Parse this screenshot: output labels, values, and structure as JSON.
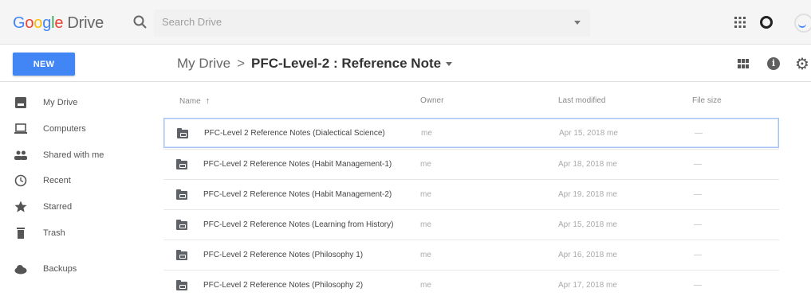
{
  "header": {
    "logo_brand": [
      "G",
      "o",
      "o",
      "g",
      "l",
      "e"
    ],
    "logo_product": "Drive",
    "search_placeholder": "Search Drive"
  },
  "toolbar": {
    "new_label": "NEW",
    "breadcrumb_root": "My Drive",
    "breadcrumb_separator": ">",
    "breadcrumb_current": "PFC-Level-2 : Reference Note"
  },
  "sidebar": {
    "items": [
      {
        "label": "My Drive",
        "icon": "my-drive-icon"
      },
      {
        "label": "Computers",
        "icon": "computers-icon"
      },
      {
        "label": "Shared with me",
        "icon": "shared-icon"
      },
      {
        "label": "Recent",
        "icon": "clock-icon"
      },
      {
        "label": "Starred",
        "icon": "star-icon"
      },
      {
        "label": "Trash",
        "icon": "trash-icon"
      },
      {
        "label": "Backups",
        "icon": "cloud-icon"
      }
    ]
  },
  "list": {
    "columns": {
      "name": "Name",
      "owner": "Owner",
      "modified": "Last modified",
      "size": "File size"
    },
    "sort_arrow": "↑",
    "rows": [
      {
        "name": "PFC-Level 2 Reference Notes (Dialectical Science)",
        "owner": "me",
        "modified": "Apr 15, 2018 me",
        "size": "—"
      },
      {
        "name": "PFC-Level 2 Reference Notes (Habit Management-1)",
        "owner": "me",
        "modified": "Apr 18, 2018 me",
        "size": "—"
      },
      {
        "name": "PFC-Level 2 Reference Notes (Habit Management-2)",
        "owner": "me",
        "modified": "Apr 19, 2018 me",
        "size": "—"
      },
      {
        "name": "PFC-Level 2 Reference Notes (Learning from History)",
        "owner": "me",
        "modified": "Apr 15, 2018 me",
        "size": "—"
      },
      {
        "name": "PFC-Level 2 Reference Notes (Philosophy 1)",
        "owner": "me",
        "modified": "Apr 16, 2018 me",
        "size": "—"
      },
      {
        "name": "PFC-Level 2 Reference Notes (Philosophy 2)",
        "owner": "me",
        "modified": "Apr 17, 2018 me",
        "size": "—"
      }
    ]
  },
  "colors": {
    "primary_blue": "#4285f4",
    "selection_border": "#a7c3f3"
  }
}
